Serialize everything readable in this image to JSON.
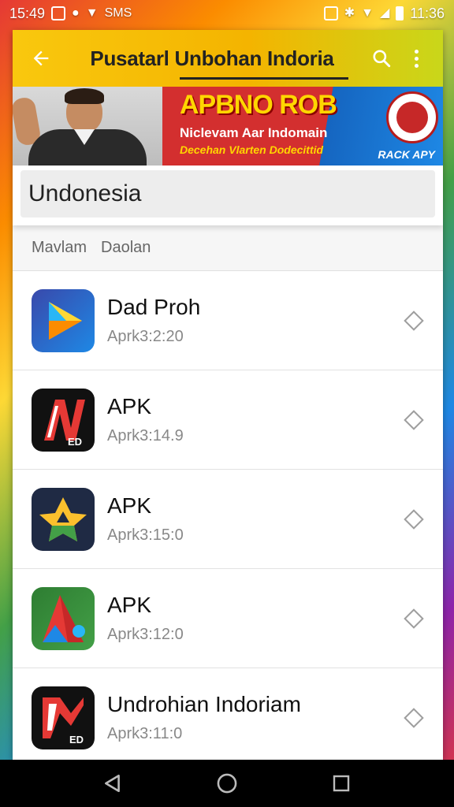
{
  "status_bar": {
    "time_left": "15:49",
    "time_right": "11:36",
    "signal_text": "SMS"
  },
  "app_bar": {
    "title": "Pusatarl Unbohan Indoria"
  },
  "banner": {
    "title": "APBNO ROB",
    "subtitle": "Niclevam Aar Indomain",
    "tagline": "Decehan Vlarten Dodecittid",
    "tag": "RACK APY"
  },
  "search": {
    "value": "Undonesia"
  },
  "filters": [
    {
      "label": "Mavlam"
    },
    {
      "label": "Daolan"
    }
  ],
  "apps": [
    {
      "title": "Dad Proh",
      "subtitle": "Aprk3:2:20",
      "icon": "play-triangle-icon"
    },
    {
      "title": "APK",
      "subtitle": "Aprk3:14.9",
      "icon": "red-n-logo-icon"
    },
    {
      "title": "APK",
      "subtitle": "Aprk3:15:0",
      "icon": "yellow-star-icon"
    },
    {
      "title": "APK",
      "subtitle": "Aprk3:12:0",
      "icon": "green-arrow-icon"
    },
    {
      "title": "Undrohian Indoriam",
      "subtitle": "Aprk3:11:0",
      "icon": "red-flag-logo-icon"
    }
  ],
  "colors": {
    "appbar": "#f4b400",
    "banner_red": "#d32f2f",
    "banner_yellow": "#ffd600"
  }
}
